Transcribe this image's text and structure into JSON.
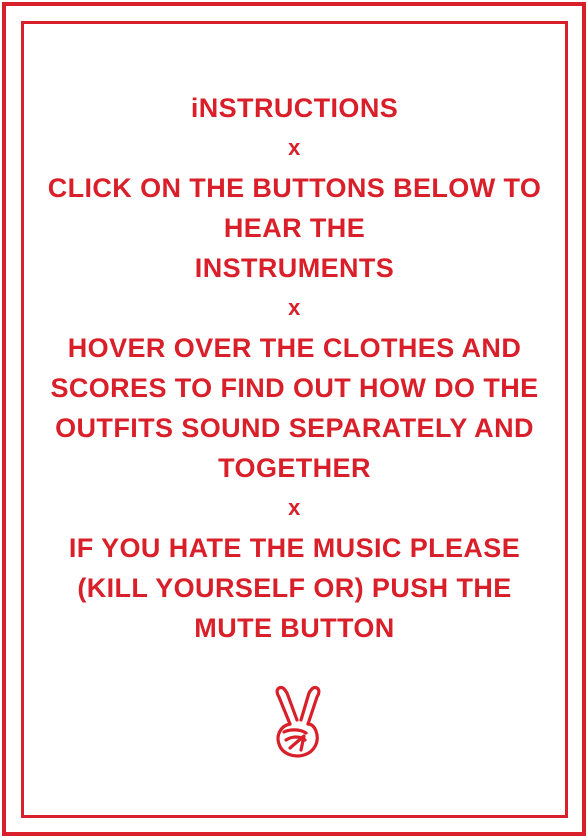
{
  "instructions": {
    "title": "iNSTRUCTIONS",
    "separator": "x",
    "step1": [
      "CLICK ON THE BUTTONS BELOW TO",
      "HEAR THE",
      "INSTRUMENTS"
    ],
    "step2": [
      "HOVER OVER THE CLOTHES AND",
      "SCORES TO FIND OUT HOW DO THE",
      "OUTFITS SOUND SEPARATELY AND",
      "TOGETHER"
    ],
    "step3": [
      "IF YOU HATE THE MUSIC PLEASE",
      "(KILL YOURSELF OR) PUSH THE",
      "MUTE BUTTON"
    ]
  },
  "icon": {
    "name": "peace-hand-icon"
  },
  "colors": {
    "accent": "#d9202a",
    "background": "#ffffff"
  }
}
